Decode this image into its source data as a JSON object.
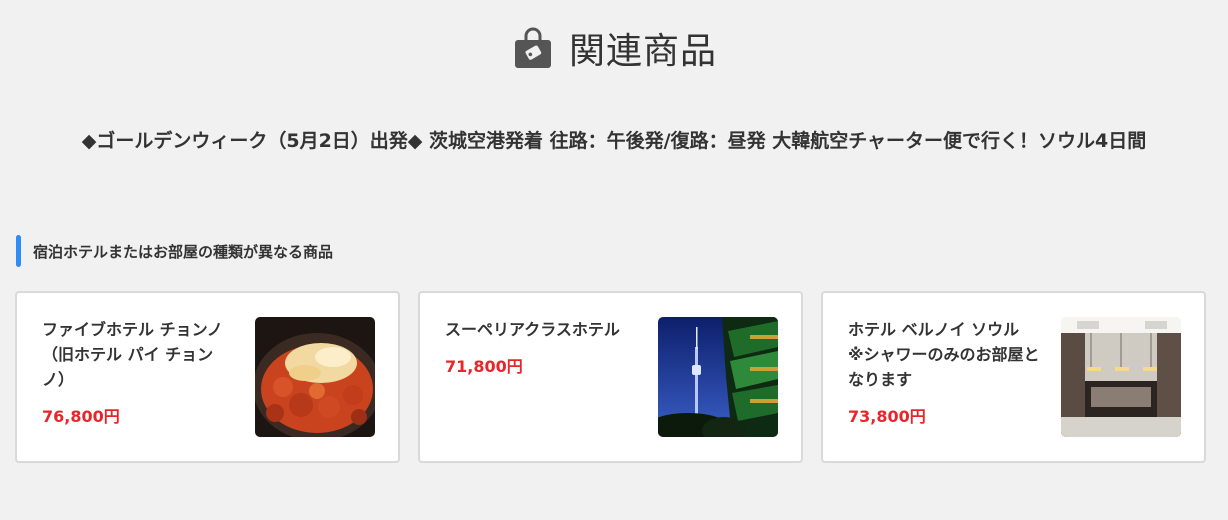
{
  "header": {
    "title": "関連商品",
    "icon": "shopping-bag-icon"
  },
  "tour": {
    "title": "◆ゴールデンウィーク（5月2日）出発◆ 茨城空港発着 往路：午後発/復路：昼発 大韓航空チャーター便で行く！ソウル4日間"
  },
  "section": {
    "heading": "宿泊ホテルまたはお部屋の種類が異なる商品"
  },
  "products": [
    {
      "name": "ファイブホテル チョンノ（旧ホテル パイ チョンノ）",
      "price": "76,800円",
      "image": "food-photo"
    },
    {
      "name": "スーペリアクラスホテル",
      "price": "71,800円",
      "image": "namsan-tower-photo"
    },
    {
      "name": "ホテル ベルノイ ソウル ※シャワーのみのお部屋となります",
      "price": "73,800円",
      "image": "hotel-lobby-photo"
    }
  ],
  "colors": {
    "accent": "#2f8cf5",
    "price": "#e8262a",
    "text": "#333333",
    "background": "#f1f1f1",
    "card_border": "#d9d9d9"
  }
}
